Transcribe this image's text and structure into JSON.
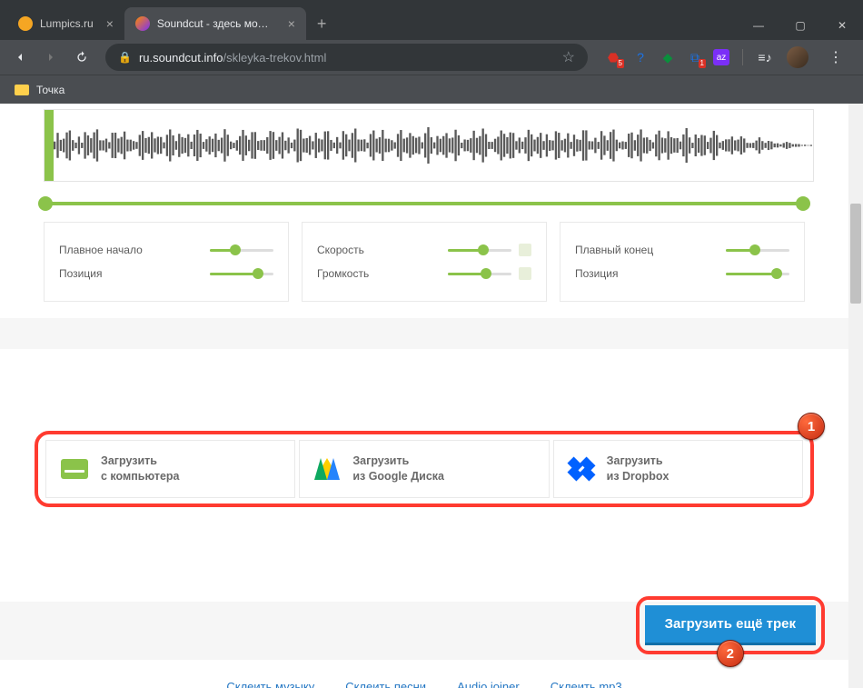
{
  "browser": {
    "tabs": [
      {
        "title": "Lumpics.ru",
        "active": false
      },
      {
        "title": "Soundcut - здесь можно обреза",
        "active": true
      }
    ],
    "url_host": "ru.soundcut.info",
    "url_path": "/skleyka-trekov.html",
    "bookmark": "Точка",
    "ext_badge_1": "5",
    "ext_badge_2": "1"
  },
  "controls": {
    "left": {
      "row1": "Плавное начало",
      "row2": "Позиция"
    },
    "mid": {
      "row1": "Скорость",
      "row2": "Громкость"
    },
    "right": {
      "row1": "Плавный конец",
      "row2": "Позиция"
    }
  },
  "upload": {
    "computer": {
      "line1": "Загрузить",
      "line2": "с компьютера"
    },
    "gdrive": {
      "line1": "Загрузить",
      "line2": "из Google Диска"
    },
    "dropbox": {
      "line1": "Загрузить",
      "line2": "из Dropbox"
    }
  },
  "annot": {
    "one": "1",
    "two": "2"
  },
  "load_more_label": "Загрузить ещё трек",
  "links": {
    "l1": "Склеить музыку",
    "l2": "Склеить песни",
    "l3": "Audio joiner",
    "l4": "Склеить mp3"
  }
}
